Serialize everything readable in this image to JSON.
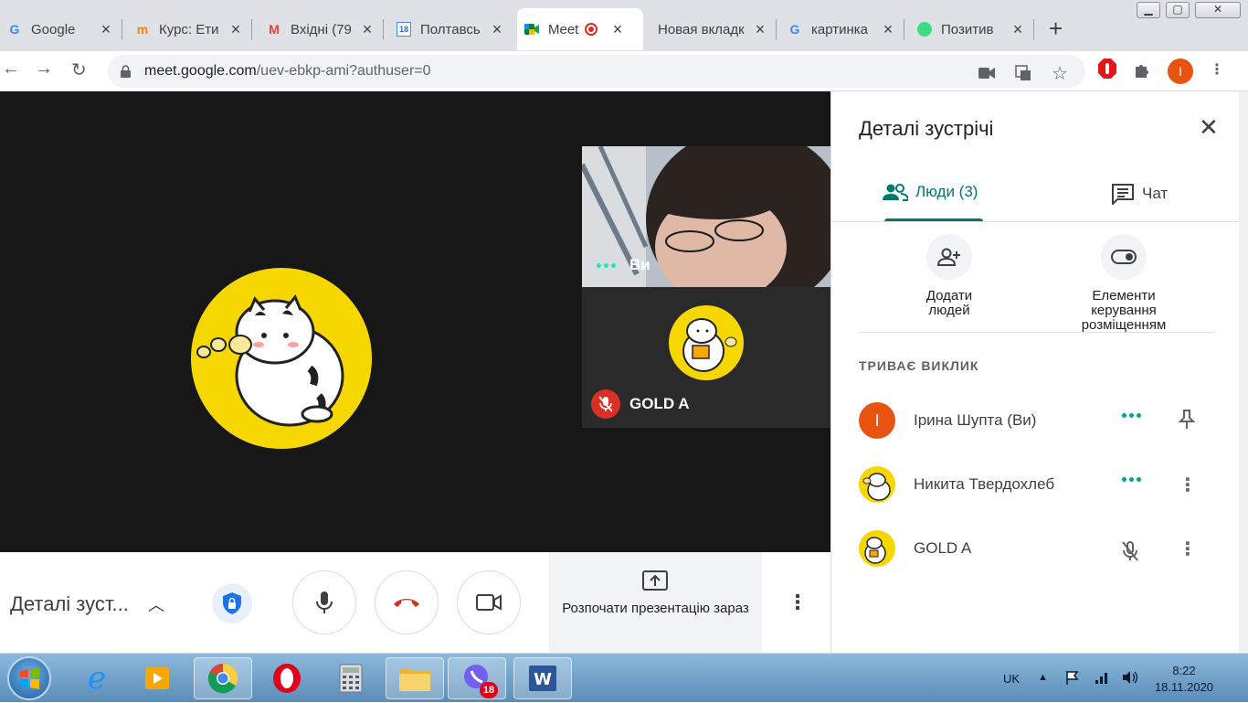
{
  "browser": {
    "tabs": [
      {
        "title": "Google",
        "icon": "google-icon",
        "active": false
      },
      {
        "title": "Курс: Ети",
        "icon": "moodle-icon",
        "active": false
      },
      {
        "title": "Вхідні (79",
        "icon": "gmail-icon",
        "active": false
      },
      {
        "title": "Полтавсь",
        "icon": "calendar-icon",
        "active": false
      },
      {
        "title": "Meet",
        "icon": "meet-icon",
        "active": true
      },
      {
        "title": "Новая вкладк",
        "icon": "",
        "active": false
      },
      {
        "title": "картинка",
        "icon": "google-icon",
        "active": false
      },
      {
        "title": "Позитив",
        "icon": "green-leaf-icon",
        "active": false
      }
    ],
    "calendar_badge": "18",
    "url_domain": "meet.google.com",
    "url_path": "/uev-ebkp-ami?authuser=0",
    "profile_initial": "I"
  },
  "stage": {
    "self_label": "Ви",
    "gold_label": "GOLD A"
  },
  "controls": {
    "details_label": "Деталі зуст...",
    "present_label": "Розпочати презентацію зараз"
  },
  "panel": {
    "title": "Деталі зустрічі",
    "tab_people": "Люди (3)",
    "tab_chat": "Чат",
    "add_people": "Додати людей",
    "host_controls": "Елементи керування розміщенням",
    "call_header": "ТРИВАЄ ВИКЛИК",
    "participants": [
      {
        "name": "Ірина Шупта (Ви)",
        "initial": "I",
        "status": "speaking-dots",
        "action": "pin-icon"
      },
      {
        "name": "Никита Твердохлеб",
        "initial": "",
        "status": "speaking-dots",
        "action": "more-vert-icon"
      },
      {
        "name": "GOLD A",
        "initial": "",
        "status": "mic-off-icon",
        "action": "more-vert-icon"
      }
    ]
  },
  "taskbar": {
    "lang": "UK",
    "time": "8:22",
    "date": "18.11.2020",
    "viber_badge": "18"
  },
  "colors": {
    "meet_green": "#00796b",
    "end_call_red": "#d93025",
    "avatar_yellow": "#f7d700",
    "profile_orange": "#e8540f"
  }
}
